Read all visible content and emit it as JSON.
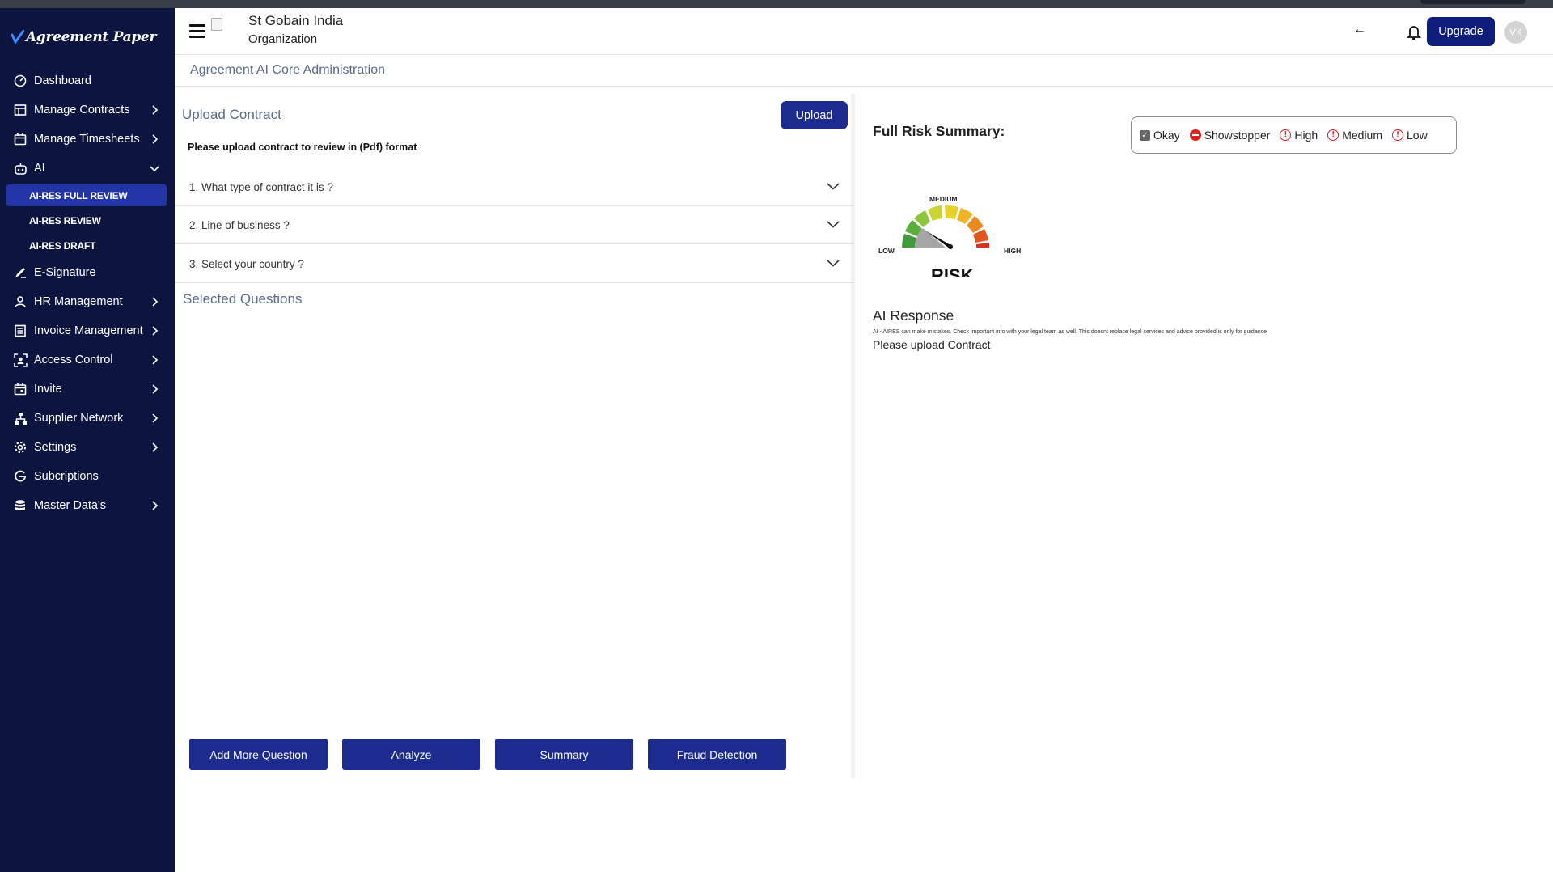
{
  "brand": {
    "logo_text": "Agreement Paper"
  },
  "header": {
    "org_name": "St Gobain India",
    "org_type": "Organization",
    "upgrade_label": "Upgrade",
    "avatar_initials": "VK"
  },
  "sidebar": {
    "items": [
      {
        "label": "Dashboard",
        "icon": "dashboard-icon"
      },
      {
        "label": "Manage Contracts",
        "icon": "contracts-icon"
      },
      {
        "label": "Manage Timesheets",
        "icon": "calendar-icon"
      },
      {
        "label": "AI",
        "icon": "robot-icon"
      },
      {
        "label": "E-Signature",
        "icon": "signature-icon"
      },
      {
        "label": "HR Management",
        "icon": "person-icon"
      },
      {
        "label": "Invoice Management",
        "icon": "invoice-icon"
      },
      {
        "label": "Access Control",
        "icon": "access-icon"
      },
      {
        "label": "Invite",
        "icon": "invite-icon"
      },
      {
        "label": "Supplier Network",
        "icon": "network-icon"
      },
      {
        "label": "Settings",
        "icon": "gear-icon"
      },
      {
        "label": "Subcriptions",
        "icon": "subscription-icon"
      },
      {
        "label": "Master Data's",
        "icon": "database-icon"
      }
    ],
    "ai_sub": [
      {
        "label": "AI-RES FULL REVIEW",
        "active": true
      },
      {
        "label": "AI-RES REVIEW"
      },
      {
        "label": "AI-RES DRAFT"
      }
    ]
  },
  "page": {
    "title": "Agreement AI Core Administration"
  },
  "upload": {
    "title": "Upload Contract",
    "button": "Upload",
    "instruction": "Please upload contract to review in (Pdf) format",
    "questions": [
      "1. What type of contract it is ?",
      "2. Line of business ?",
      "3. Select your country ?"
    ],
    "selected_title": "Selected Questions",
    "actions": [
      "Add More Question",
      "Analyze",
      "Summary",
      "Fraud Detection"
    ]
  },
  "risk": {
    "title": "Full Risk Summary:",
    "legend": [
      "Okay",
      "Showstopper",
      "High",
      "Medium",
      "Low"
    ],
    "gauge": {
      "low": "LOW",
      "medium": "MEDIUM",
      "high": "HIGH",
      "caption": "RISK"
    },
    "colors": {
      "low": "#3f9b3c",
      "medium": "#e8d22a",
      "high": "#d8321c"
    }
  },
  "ai_response": {
    "title": "AI Response",
    "disclaimer": "AI - AIRES can make mistakes. Check important info with your legal team as well. This doesnt replace legal services and advice provided is only for guidance",
    "message": "Please upload Contract"
  }
}
